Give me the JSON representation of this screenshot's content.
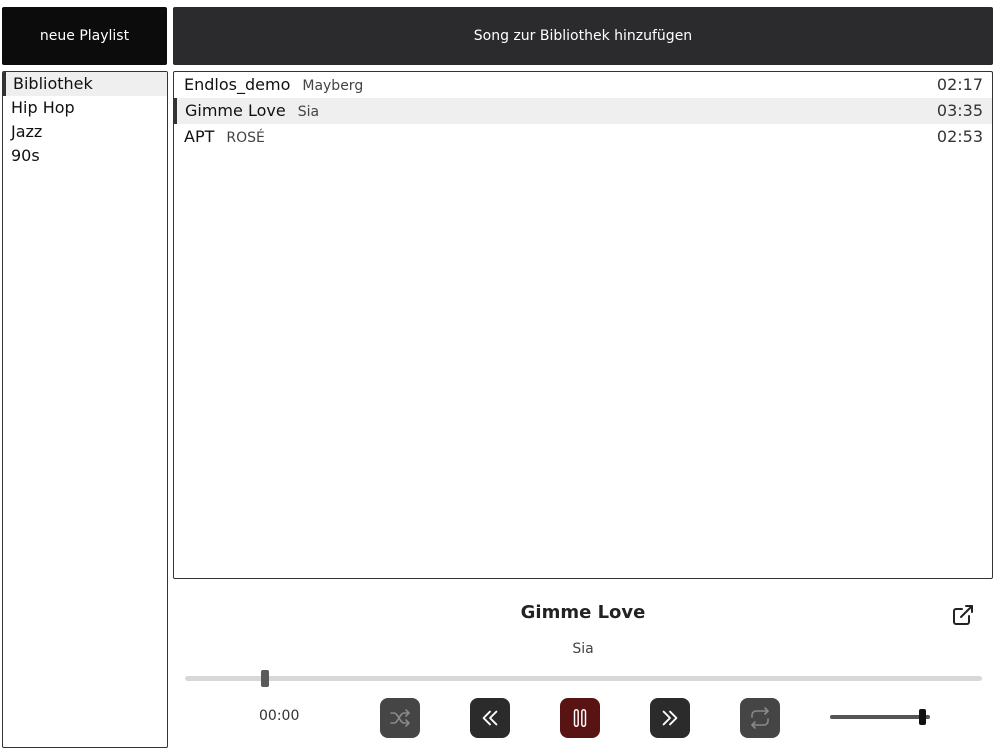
{
  "toolbar": {
    "new_playlist_label": "neue Playlist",
    "add_song_label": "Song zur Bibliothek hinzufügen"
  },
  "sidebar": {
    "items": [
      {
        "label": "Bibliothek",
        "active": true
      },
      {
        "label": "Hip Hop",
        "active": false
      },
      {
        "label": "Jazz",
        "active": false
      },
      {
        "label": "90s",
        "active": false
      }
    ]
  },
  "songs": [
    {
      "title": "Endlos_demo",
      "artist": "Mayberg",
      "duration": "02:17",
      "active": false
    },
    {
      "title": "Gimme Love",
      "artist": "Sia",
      "duration": "03:35",
      "active": true
    },
    {
      "title": "APT",
      "artist": "ROSÉ",
      "duration": "02:53",
      "active": false
    }
  ],
  "player": {
    "title": "Gimme Love",
    "artist": "Sia",
    "current_time": "00:00",
    "progress_fraction": 0.1,
    "volume_fraction": 0.92,
    "icons": {
      "popout": "external-link-icon",
      "shuffle": "shuffle-icon",
      "prev": "skip-back-icon",
      "play": "pause-icon",
      "next": "skip-forward-icon",
      "repeat": "repeat-icon"
    }
  },
  "colors": {
    "dark_button": "#2b2b2d",
    "black_button": "#0c0c0d",
    "play_button": "#5a1313",
    "disabled_button": "#454545",
    "active_row": "#efefef"
  }
}
